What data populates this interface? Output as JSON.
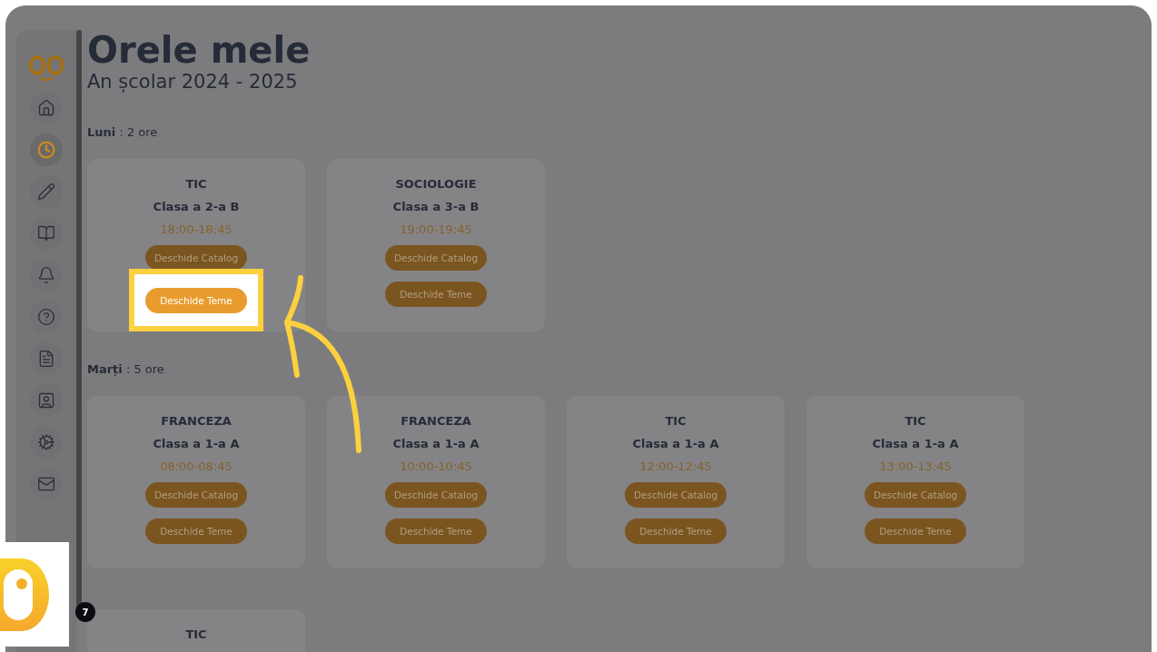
{
  "page": {
    "title": "Orele mele",
    "subtitle": "An școlar 2024 - 2025"
  },
  "sidebar": {
    "items": [
      {
        "kind": "home",
        "selected": false
      },
      {
        "kind": "clock",
        "selected": true
      },
      {
        "kind": "pencil",
        "selected": false
      },
      {
        "kind": "book",
        "selected": false
      },
      {
        "kind": "bell",
        "selected": false
      },
      {
        "kind": "help",
        "selected": false
      },
      {
        "kind": "document",
        "selected": false
      },
      {
        "kind": "profile",
        "selected": false
      },
      {
        "kind": "settings",
        "selected": false
      },
      {
        "kind": "mail",
        "selected": false
      }
    ]
  },
  "days": [
    {
      "heading": "**Luni** : 2 ore",
      "lessons": [
        {
          "subject": "TIC",
          "class": "Clasa a 2-a B",
          "time": "18:00-18:45",
          "buttons": [
            {
              "label": "Deschide Catalog",
              "highlighted": false
            },
            {
              "label": "Deschide Teme",
              "highlighted": true
            }
          ]
        },
        {
          "subject": "SOCIOLOGIE",
          "class": "Clasa a 3-a B",
          "time": "19:00-19:45",
          "buttons": [
            {
              "label": "Deschide Catalog",
              "highlighted": false
            },
            {
              "label": "Deschide Teme",
              "highlighted": false
            }
          ]
        }
      ]
    },
    {
      "heading": "**Marți** : 5 ore",
      "lessons": [
        {
          "subject": "FRANCEZA",
          "class": "Clasa a 1-a A",
          "time": "08:00-08:45",
          "buttons": [
            {
              "label": "Deschide Catalog",
              "highlighted": false
            },
            {
              "label": "Deschide Teme",
              "highlighted": false
            }
          ]
        },
        {
          "subject": "FRANCEZA",
          "class": "Clasa a 1-a A",
          "time": "10:00-10:45",
          "buttons": [
            {
              "label": "Deschide Catalog",
              "highlighted": false
            },
            {
              "label": "Deschide Teme",
              "highlighted": false
            }
          ]
        },
        {
          "subject": "TIC",
          "class": "Clasa a 1-a A",
          "time": "12:00-12:45",
          "buttons": [
            {
              "label": "Deschide Catalog",
              "highlighted": false
            },
            {
              "label": "Deschide Teme",
              "highlighted": false
            }
          ]
        },
        {
          "subject": "TIC",
          "class": "Clasa a 1-a A",
          "time": "13:00-13:45",
          "buttons": [
            {
              "label": "Deschide Catalog",
              "highlighted": false
            },
            {
              "label": "Deschide Teme",
              "highlighted": false
            }
          ]
        }
      ]
    },
    {
      "lessons": [
        {
          "subject": "TIC"
        }
      ]
    }
  ],
  "badge": "7"
}
